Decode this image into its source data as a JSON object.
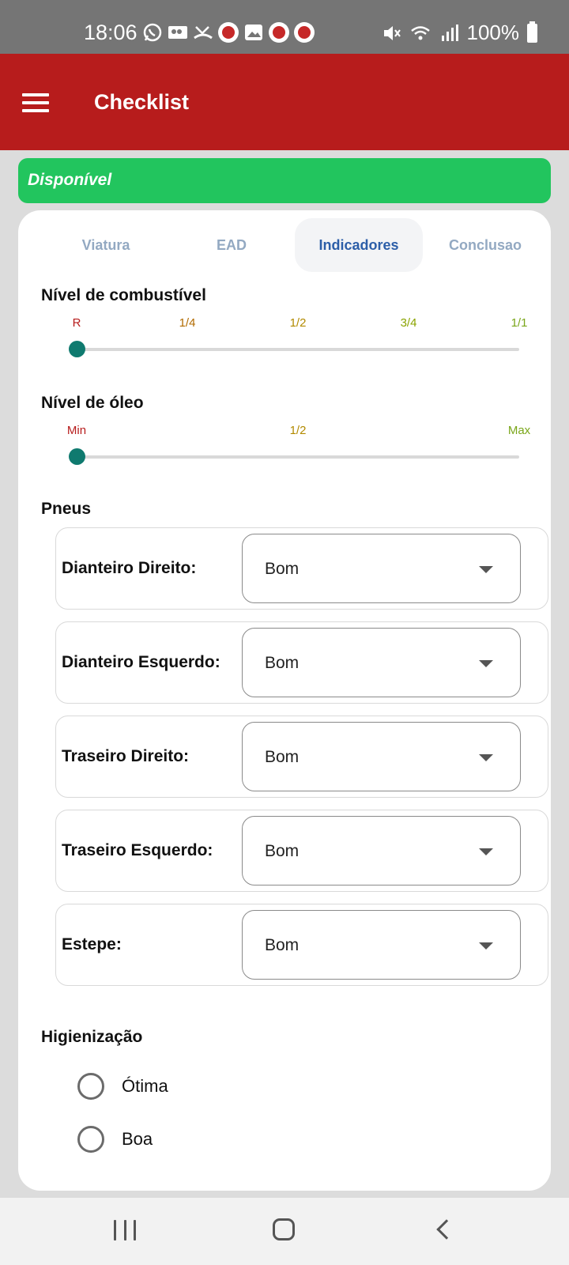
{
  "status_bar": {
    "time": "18:06",
    "battery": "100%",
    "notification_icons": [
      "whatsapp-icon",
      "voicemail-icon",
      "missed-call-icon",
      "app-icon",
      "image-icon",
      "app-icon",
      "app-icon"
    ],
    "system_icons": [
      "mute-icon",
      "wifi-icon",
      "signal-icon",
      "battery-icon"
    ]
  },
  "app_bar": {
    "title": "Checklist",
    "background": "#b71c1c",
    "menu_icon": "hamburger-menu-icon"
  },
  "banner": {
    "text": "Disponível",
    "color": "#22c55e"
  },
  "tabs": [
    {
      "label": "Viatura",
      "active": false
    },
    {
      "label": "EAD",
      "active": false
    },
    {
      "label": "Indicadores",
      "active": true
    },
    {
      "label": "Conclusao",
      "active": false
    }
  ],
  "fuel": {
    "title": "Nível de combustível",
    "labels": [
      {
        "text": "R",
        "color": "#b71c1c"
      },
      {
        "text": "1/4",
        "color": "#b26b00"
      },
      {
        "text": "1/2",
        "color": "#b28a00"
      },
      {
        "text": "3/4",
        "color": "#8aa300"
      },
      {
        "text": "1/1",
        "color": "#7aa61a"
      }
    ],
    "value_fraction": 0,
    "thumb_color": "#0f7a6f"
  },
  "oil": {
    "title": "Nível de óleo",
    "labels": [
      {
        "text": "Min",
        "color": "#b71c1c"
      },
      {
        "text": "1/2",
        "color": "#b28a00"
      },
      {
        "text": "Max",
        "color": "#7aa61a"
      }
    ],
    "value_fraction": 0,
    "thumb_color": "#0f7a6f"
  },
  "tires": {
    "title": "Pneus",
    "items": [
      {
        "label": "Dianteiro Direito:",
        "value": "Bom"
      },
      {
        "label": "Dianteiro Esquerdo:",
        "value": "Bom"
      },
      {
        "label": "Traseiro Direito:",
        "value": "Bom"
      },
      {
        "label": "Traseiro Esquerdo:",
        "value": "Bom"
      },
      {
        "label": "Estepe:",
        "value": "Bom"
      }
    ]
  },
  "hygiene": {
    "title": "Higienização",
    "options": [
      "Ótima",
      "Boa"
    ]
  },
  "nav_bar": {
    "icons": [
      "recent-apps-icon",
      "home-icon",
      "back-icon"
    ]
  }
}
